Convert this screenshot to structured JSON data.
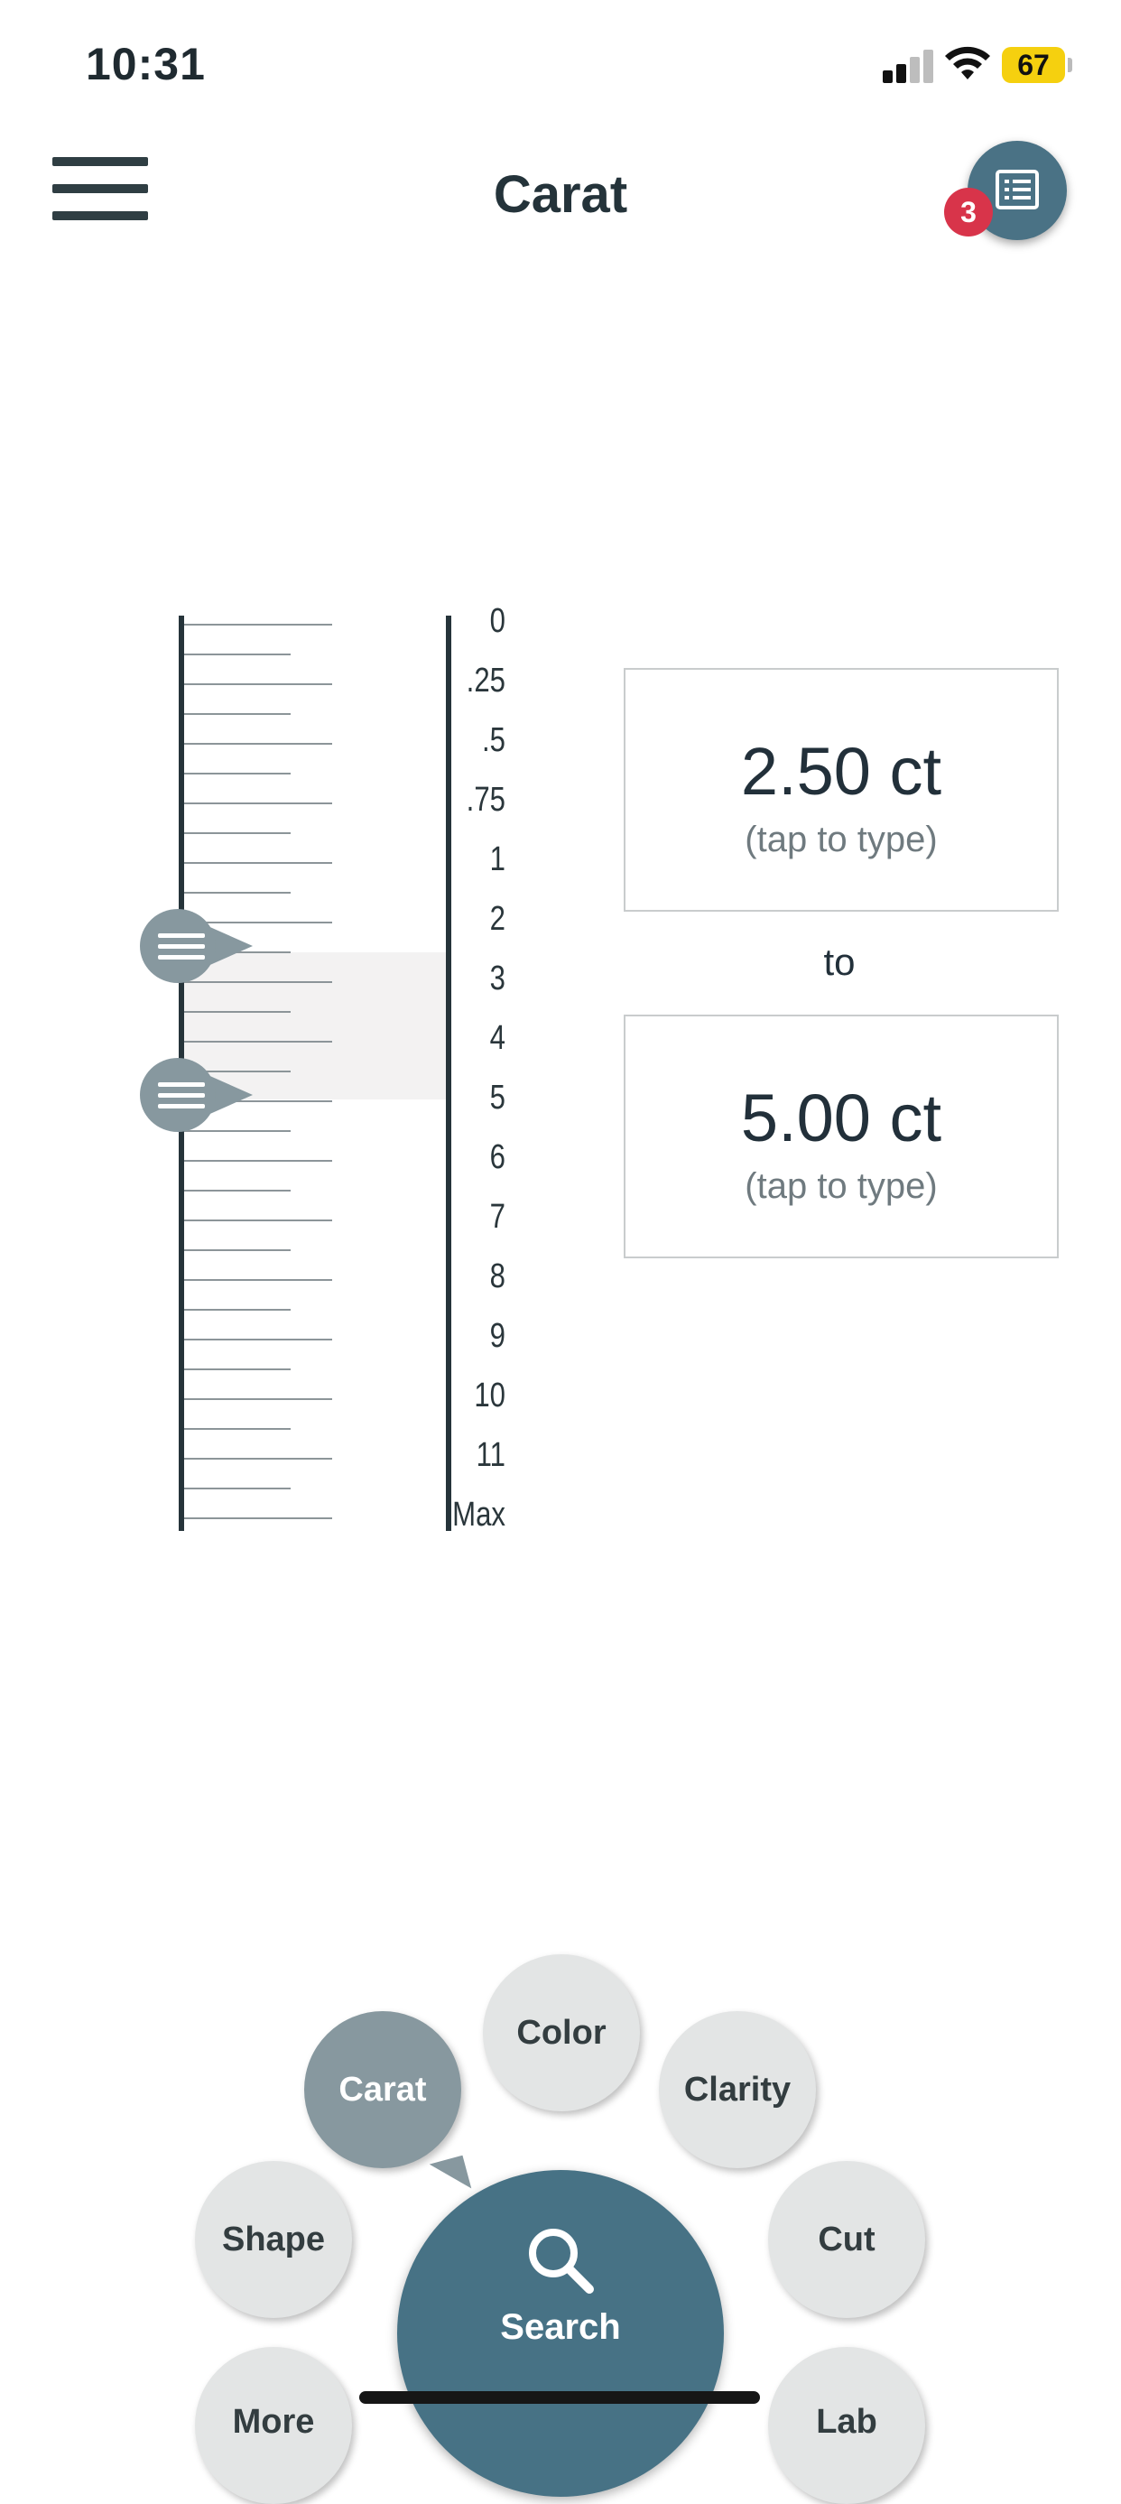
{
  "status_bar": {
    "time": "10:31",
    "battery": "67"
  },
  "header": {
    "title": "Carat",
    "notification_count": "3"
  },
  "ruler": {
    "labels": [
      "0",
      ".25",
      ".5",
      ".75",
      "1",
      "2",
      "3",
      "4",
      "5",
      "6",
      "7",
      "8",
      "9",
      "10",
      "11",
      "Max"
    ],
    "selected_min_label": "2.50",
    "selected_max_label": "5"
  },
  "range": {
    "from_value": "2.50 ct",
    "from_hint": "(tap to type)",
    "separator": "to",
    "to_value": "5.00 ct",
    "to_hint": "(tap to type)"
  },
  "bottom_nav": {
    "items": [
      {
        "label": "Carat",
        "active": true
      },
      {
        "label": "Color",
        "active": false
      },
      {
        "label": "Clarity",
        "active": false
      },
      {
        "label": "Shape",
        "active": false
      },
      {
        "label": "Cut",
        "active": false
      },
      {
        "label": "More",
        "active": false
      },
      {
        "label": "Lab",
        "active": false
      }
    ],
    "search_label": "Search"
  },
  "colors": {
    "accent": "#477285",
    "handle": "#87989f",
    "badge": "#d8344a"
  }
}
